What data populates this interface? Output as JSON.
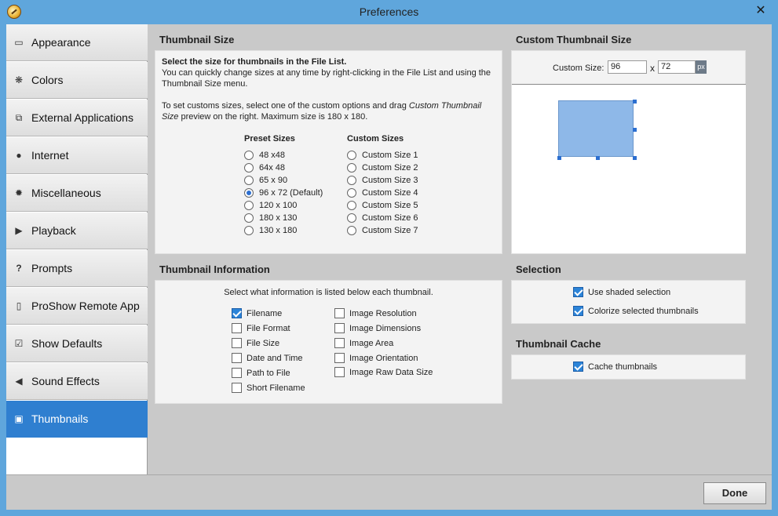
{
  "window": {
    "title": "Preferences",
    "close_glyph": "✕"
  },
  "sidebar": {
    "items": [
      {
        "label": "Appearance",
        "icon": "window-icon",
        "glyph": "▭"
      },
      {
        "label": "Colors",
        "icon": "color-wheel-icon",
        "glyph": "❋"
      },
      {
        "label": "External Applications",
        "icon": "external-app-icon",
        "glyph": "⧉"
      },
      {
        "label": "Internet",
        "icon": "globe-icon",
        "glyph": "●"
      },
      {
        "label": "Miscellaneous",
        "icon": "gear-icon",
        "glyph": "✹"
      },
      {
        "label": "Playback",
        "icon": "play-icon",
        "glyph": "▶"
      },
      {
        "label": "Prompts",
        "icon": "question-icon",
        "glyph": "?"
      },
      {
        "label": "ProShow Remote App",
        "icon": "phone-icon",
        "glyph": "▯"
      },
      {
        "label": "Show Defaults",
        "icon": "checklist-icon",
        "glyph": "☑"
      },
      {
        "label": "Sound Effects",
        "icon": "speaker-icon",
        "glyph": "◀"
      },
      {
        "label": "Thumbnails",
        "icon": "thumbnail-icon",
        "glyph": "▣"
      }
    ],
    "active_index": 10
  },
  "thumbnail_size": {
    "title": "Thumbnail Size",
    "intro_bold": "Select the size for thumbnails in the File List.",
    "intro_line1": "You can quickly change sizes at any time by right-clicking in the File List and using the",
    "intro_line2": "Thumbnail Size menu.",
    "custom_line1_pre": "To set customs sizes, select one of the custom options and drag ",
    "custom_line1_italic": "Custom Thumbnail",
    "custom_line2_italic": "Size",
    "custom_line2_post": " preview on the right. Maximum size is 180 x 180.",
    "preset_heading": "Preset Sizes",
    "custom_heading": "Custom Sizes",
    "presets": [
      "48 x48",
      "64x 48",
      "65 x 90",
      "96 x 72 (Default)",
      "120 x 100",
      "180 x 130",
      "130 x 180"
    ],
    "preset_selected": 3,
    "customs": [
      "Custom Size 1",
      "Custom Size 2",
      "Custom Size 3",
      "Custom Size 4",
      "Custom Size 5",
      "Custom Size 6",
      "Custom Size 7"
    ]
  },
  "custom_thumbnail": {
    "title": "Custom Thumbnail Size",
    "label": "Custom Size:",
    "width": "96",
    "separator": "x",
    "height": "72",
    "unit": "px"
  },
  "thumbnail_info": {
    "title": "Thumbnail Information",
    "intro": "Select what information is listed below each thumbnail.",
    "left": [
      {
        "label": "Filename",
        "checked": true
      },
      {
        "label": "File Format",
        "checked": false
      },
      {
        "label": "File Size",
        "checked": false
      },
      {
        "label": "Date and Time",
        "checked": false
      },
      {
        "label": "Path to File",
        "checked": false
      },
      {
        "label": "Short Filename",
        "checked": false
      }
    ],
    "right": [
      {
        "label": "Image Resolution",
        "checked": false
      },
      {
        "label": "Image Dimensions",
        "checked": false
      },
      {
        "label": "Image Area",
        "checked": false
      },
      {
        "label": "Image Orientation",
        "checked": false
      },
      {
        "label": "Image Raw Data Size",
        "checked": false
      }
    ]
  },
  "selection": {
    "title": "Selection",
    "options": [
      {
        "label": "Use shaded selection",
        "checked": true
      },
      {
        "label": "Colorize selected thumbnails",
        "checked": true
      }
    ]
  },
  "thumbnail_cache": {
    "title": "Thumbnail Cache",
    "options": [
      {
        "label": "Cache thumbnails",
        "checked": true
      }
    ]
  },
  "footer": {
    "done_label": "Done"
  }
}
